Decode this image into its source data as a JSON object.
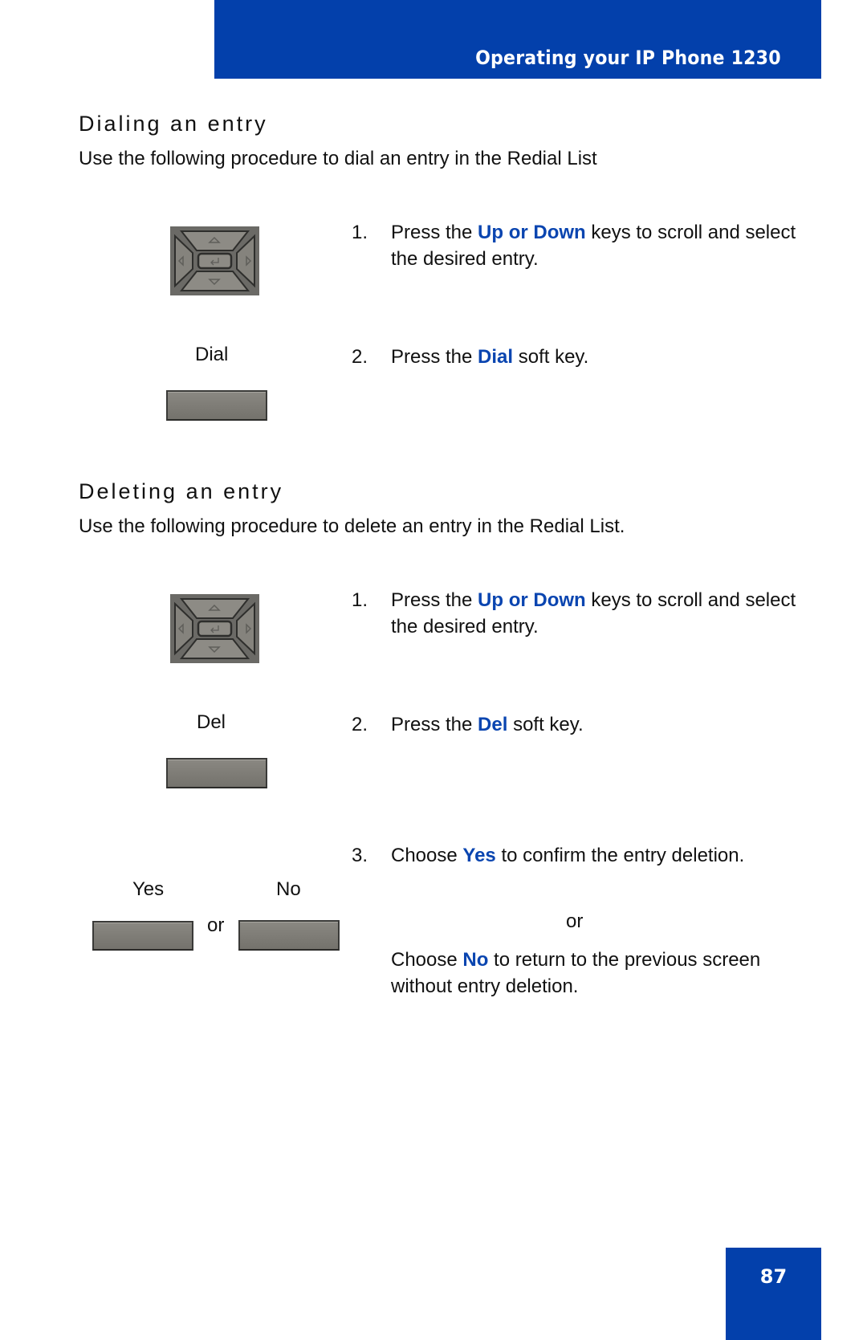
{
  "header": {
    "title": "Operating your IP Phone 1230"
  },
  "sections": [
    {
      "title": "Dialing an entry",
      "intro": "Use the following procedure to dial an entry in the Redial List",
      "steps": [
        {
          "number": "1.",
          "pre": "Press the ",
          "highlight": "Up or Down",
          "post": " keys to scroll and select the desired entry.",
          "visual": "navigation-cluster"
        },
        {
          "number": "2.",
          "pre": "Press the ",
          "highlight": "Dial",
          "post": " soft key.",
          "visual": "softkey",
          "key_label": "Dial"
        }
      ]
    },
    {
      "title": "Deleting an entry",
      "intro": "Use the following procedure to delete an entry in the Redial List.",
      "steps": [
        {
          "number": "1.",
          "pre": "Press the ",
          "highlight": "Up or Down",
          "post": " keys to scroll and select the desired entry.",
          "visual": "navigation-cluster"
        },
        {
          "number": "2.",
          "pre": "Press the ",
          "highlight": "Del",
          "post": " soft key.",
          "visual": "softkey",
          "key_label": "Del"
        },
        {
          "number": "3.",
          "pre": "Choose ",
          "highlight": "Yes",
          "post": " to confirm the entry deletion.",
          "or": "or",
          "alt_pre": "Choose ",
          "alt_highlight": "No",
          "alt_post": " to return to the previous screen without entry deletion.",
          "visual": "softkey-pair",
          "key_labels": [
            "Yes",
            "No"
          ],
          "between_keys": "or"
        }
      ]
    }
  ],
  "footer": {
    "page_number": "87"
  },
  "colors": {
    "brand_blue": "#0340ab",
    "highlight_blue": "#0a45b0",
    "key_gray": "#7f7d77"
  }
}
